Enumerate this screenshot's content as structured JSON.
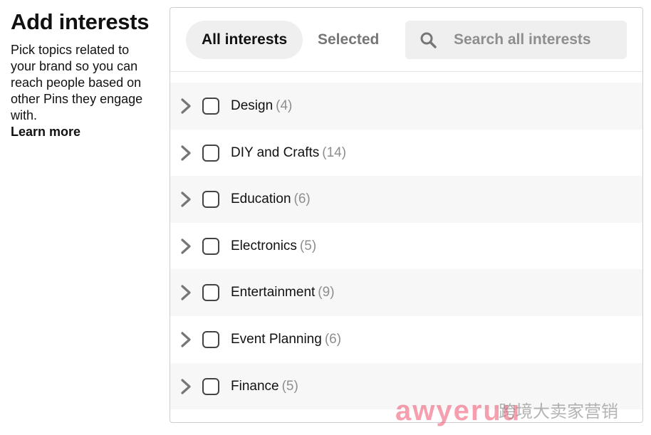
{
  "sidebar": {
    "title": "Add interests",
    "description": "Pick topics related to your brand so you can reach people based on other Pins they engage with.",
    "learn_more": "Learn more"
  },
  "tabs": {
    "all": "All interests",
    "selected": "Selected"
  },
  "search": {
    "placeholder": "Search all interests",
    "value": ""
  },
  "interests": [
    {
      "name": "Design",
      "count": "(4)"
    },
    {
      "name": "DIY and Crafts",
      "count": "(14)"
    },
    {
      "name": "Education",
      "count": "(6)"
    },
    {
      "name": "Electronics",
      "count": "(5)"
    },
    {
      "name": "Entertainment",
      "count": "(9)"
    },
    {
      "name": "Event Planning",
      "count": "(6)"
    },
    {
      "name": "Finance",
      "count": "(5)"
    }
  ],
  "watermark": {
    "text": "awyeruu",
    "sub": "跨境大卖家营销"
  },
  "colors": {
    "tab_active_bg": "#efefef",
    "row_shaded_bg": "#f7f7f7",
    "count_gray": "#8e8e8e",
    "watermark_pink": "#ec506e"
  }
}
